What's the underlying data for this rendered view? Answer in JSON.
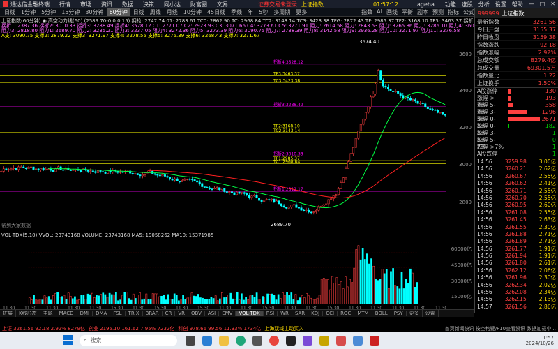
{
  "app": {
    "name": "通达信金融终端",
    "menu": [
      "行情",
      "市场",
      "资讯",
      "数据",
      "决策",
      "同小达",
      "财富圈",
      "文易"
    ],
    "notice_label": "证券交易未登录",
    "notice_index": "上证指数",
    "time": "01:57:12",
    "user": "ageha",
    "right_menu": [
      "功能",
      "选股",
      "分析",
      "设置",
      "帮助"
    ]
  },
  "toolbar": {
    "periods": [
      "日线",
      "1分钟",
      "5分钟",
      "15分钟",
      "30分钟",
      "60分钟",
      "日线",
      "周线",
      "月线",
      "10分钟",
      "45日线",
      "季线",
      "年",
      "5秒",
      "多周期",
      "更多"
    ],
    "selected_period_index": 5,
    "right_items": [
      "指数",
      "AI",
      "画线",
      "平衡",
      "副本",
      "预测",
      "指标",
      "公式"
    ]
  },
  "info": {
    "line1": "上证指数(60分钟) ◉ 高空动力线(60) (2589.70-0.0.0.15) 拥抢: 2747.74 01: 2783.61 TC0: 2862.90 TC: 2968.84 TC2: 3143.14 TC3: 3423.38 TFG: 2872.43 TF: 2985.37 TF2: 3168.10 TF3: 3463.37 拐折0: 2812.17",
    "line2": "拐折1: 2387.36 拐折2: 3010.33 拐折3: 3288.49 拐折4: 3528.12 C1: 2771.07 C2: 2923.93 C3: 3071.66 C4: 3273.61 C5: 3271.91 阻力: 2614.58 阻力: 2843.53 阻力: 3265.86 阻力: 3286.10 阻力4: 3605.10 阻力7: 2805.56 阻力4: 2888.42",
    "line3": "阻力3: 2818.80 阻力1: 2689.70 阻力2: 3235.21 阻力3: 3237.05 阻力4: 3272.36 阻力5: 3273.39 阻力6: 3090.75 阻力7: 2738.39 阻力8: 3142.58 阻力9: 2936.28 阻力10: 3271.97 阻力11: 3276.58",
    "line4": "A支: 3090.75 支撑2: 2879.22 支撑3: 3271.97 支撑4: 3278.55 支撑5: 3275.39 支撑6: 3268.43 支撑7: 3271.67"
  },
  "price_axis": {
    "labels": [
      "3600",
      "3400",
      "3200",
      "3000",
      "2800"
    ]
  },
  "vol_axis": {
    "labels": [
      "60000亿",
      "45000亿",
      "30000亿",
      "15000亿"
    ]
  },
  "chart_data": {
    "type": "candlestick",
    "title": "上证指数(60分钟)",
    "ylim": [
      2600,
      3700
    ],
    "high_label": "3674.40",
    "low_label": "2689.70",
    "date_labels": [
      "11.30",
      "11.30",
      "11.30",
      "11.30",
      "11.30",
      "15.30",
      "11.30",
      "15.30",
      "11.30",
      "15.30",
      "11.30",
      "11.30",
      "15.30",
      "11.30",
      "11.30",
      "15.30",
      "11.30",
      "11.30",
      "11.30",
      "11.30",
      "11.30"
    ],
    "levels": [
      {
        "name": "拐折4:3528.12",
        "price": 3528,
        "color": "#ff00ff"
      },
      {
        "name": "拐折3:3288.49",
        "price": 3288,
        "color": "#ff00ff"
      },
      {
        "name": "TF3:3463.37",
        "price": 3463,
        "color": "#ffff00"
      },
      {
        "name": "TC3:3423.38",
        "price": 3423,
        "color": "#ffff00"
      },
      {
        "name": "TF2:3168.10",
        "price": 3168,
        "color": "#ffff00"
      },
      {
        "name": "TC2:3143.14",
        "price": 3143,
        "color": "#ffff00"
      },
      {
        "name": "拐折2:3010.33",
        "price": 3010,
        "color": "#ff00ff"
      },
      {
        "name": "TF1:2985.37",
        "price": 2985,
        "color": "#ffff00"
      },
      {
        "name": "TC1:2968.84",
        "price": 2968,
        "color": "#ffff00"
      },
      {
        "name": "拐折1:2812.17",
        "price": 2812,
        "color": "#ff00ff"
      }
    ],
    "volume_label": "VOL-TDX(5,10) VVOL: 23743168 VOLUME: 23743168 MA5: 19058262 MA10: 15371985",
    "footnote": "帮到大家数据"
  },
  "right_panel": {
    "header_code": "999999",
    "header_name": "上证指数",
    "stats": [
      {
        "label": "最新指数",
        "value": "3261.56"
      },
      {
        "label": "今日开盘",
        "value": "3155.37"
      },
      {
        "label": "昨日收盘",
        "value": "3159.38"
      },
      {
        "label": "指数涨跌",
        "value": "92.18"
      },
      {
        "label": "指数涨幅",
        "value": "2.92%"
      },
      {
        "label": "总成交额",
        "value": "8279.4亿"
      },
      {
        "label": "总成交量",
        "value": "69301.5万"
      },
      {
        "label": "指数量比",
        "value": "1.22"
      },
      {
        "label": "上证换手",
        "value": "1.50%"
      }
    ],
    "breadth": [
      {
        "label": "A股涨停",
        "value": "130",
        "color": "#ff4040",
        "pct": 0.08
      },
      {
        "label": "涨幅 > 7%",
        "value": "193",
        "color": "#ff4040",
        "pct": 0.11
      },
      {
        "label": "涨幅 5-7%",
        "value": "358",
        "color": "#ff4040",
        "pct": 0.16
      },
      {
        "label": "涨幅 3-5%",
        "value": "1296",
        "color": "#ff4040",
        "pct": 0.6
      },
      {
        "label": "涨幅 0-3%",
        "value": "2671",
        "color": "#ff4040",
        "pct": 1.0
      },
      {
        "label": "跌幅 0-3%",
        "value": "182",
        "color": "#00cc00",
        "pct": 0.05
      },
      {
        "label": "跌幅 3-5%",
        "value": "1",
        "color": "#00cc00",
        "pct": 0.01
      },
      {
        "label": "跌幅 5-7%",
        "value": "0",
        "color": "#00cc00",
        "pct": 0
      },
      {
        "label": "跌幅 >7%",
        "value": "1",
        "color": "#00cc00",
        "pct": 0.01
      },
      {
        "label": "A股跌停",
        "value": "1",
        "color": "#00cc00",
        "pct": 0.01
      }
    ],
    "ticks": [
      {
        "t": "14:56",
        "p": "3259.98",
        "v": "3.00亿"
      },
      {
        "t": "14:56",
        "p": "3260.21",
        "v": "2.62亿"
      },
      {
        "t": "14:56",
        "p": "3260.67",
        "v": "2.55亿"
      },
      {
        "t": "14:56",
        "p": "3260.62",
        "v": "2.41亿"
      },
      {
        "t": "14:56",
        "p": "3260.71",
        "v": "2.55亿"
      },
      {
        "t": "14:56",
        "p": "3260.70",
        "v": "2.55亿"
      },
      {
        "t": "14:56",
        "p": "3260.95",
        "v": "2.60亿"
      },
      {
        "t": "14:56",
        "p": "3261.08",
        "v": "2.55亿"
      },
      {
        "t": "14:56",
        "p": "3261.45",
        "v": "2.63亿"
      },
      {
        "t": "14:56",
        "p": "3261.55",
        "v": "2.30亿"
      },
      {
        "t": "14:56",
        "p": "3261.88",
        "v": "2.71亿"
      },
      {
        "t": "14:56",
        "p": "3261.89",
        "v": "2.71亿"
      },
      {
        "t": "14:56",
        "p": "3261.77",
        "v": "1.91亿"
      },
      {
        "t": "14:56",
        "p": "3261.94",
        "v": "1.91亿"
      },
      {
        "t": "14:56",
        "p": "3261.80",
        "v": "2.61亿"
      },
      {
        "t": "14:56",
        "p": "3262.12",
        "v": "2.06亿"
      },
      {
        "t": "14:56",
        "p": "3261.96",
        "v": "2.30亿"
      },
      {
        "t": "14:56",
        "p": "3262.34",
        "v": "2.02亿"
      },
      {
        "t": "14:56",
        "p": "3262.08",
        "v": "2.34亿"
      },
      {
        "t": "14:56",
        "p": "3262.15",
        "v": "2.13亿"
      },
      {
        "t": "14:57",
        "p": "3261.56",
        "v": "2.86亿"
      }
    ]
  },
  "bottom_tabs": [
    "扩展",
    "K线形态",
    "主题",
    "MACD",
    "DMI",
    "DMA",
    "FSL",
    "TRIX",
    "BRAR",
    "CR",
    "VR",
    "OBV",
    "ASI",
    "EMV",
    "VOL-TDX",
    "RSI",
    "WR",
    "SAR",
    "KDJ",
    "CCI",
    "ROC",
    "MTM",
    "BOLL",
    "PSY",
    "更多",
    "设置"
  ],
  "status": {
    "sh": "上证 3261.56  92.18  2.92%  8279亿",
    "sz": "创业 2195.10  161.62  7.95%  7232亿",
    "bj": "科创 978.66  99.56  11.33%  1734亿",
    "marquee": "上海双域主动买入",
    "right": "首页新闻快讯 按空格键/F10查看资讯 数据加载中..."
  },
  "taskbar": {
    "search_placeholder": "搜索",
    "time": "1:57",
    "date": "2024/10/26"
  }
}
